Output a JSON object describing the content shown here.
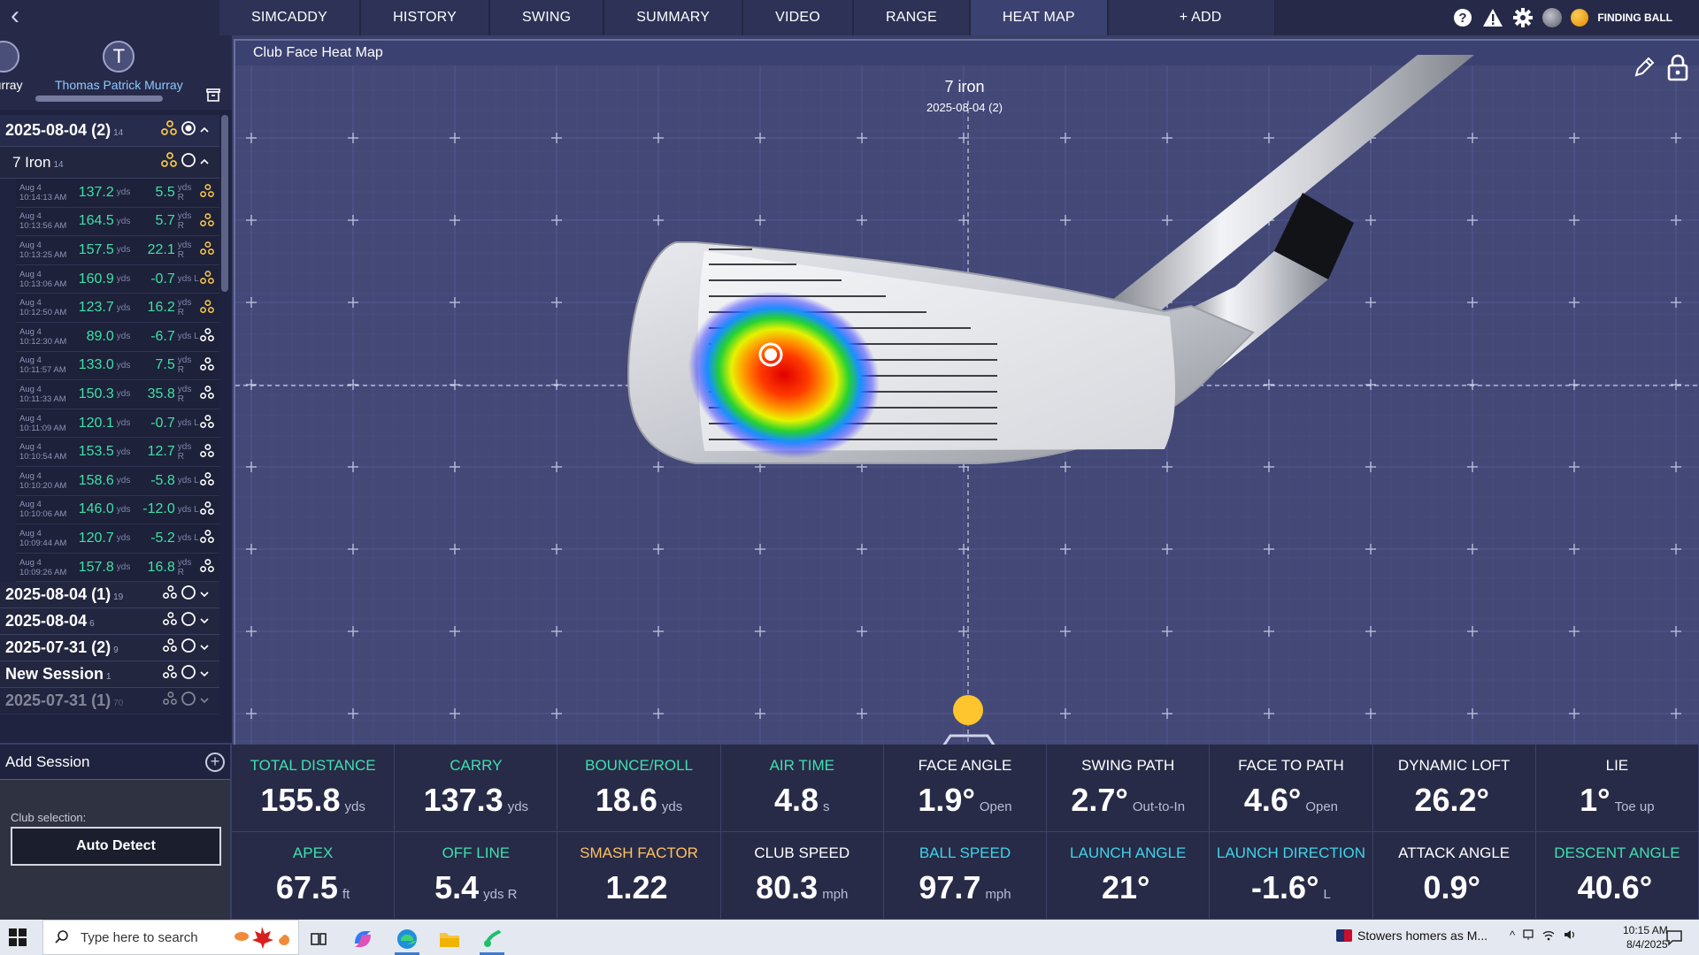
{
  "nav": {
    "tabs": [
      "SIMCADDY",
      "HISTORY",
      "SWING",
      "SUMMARY",
      "VIDEO",
      "RANGE",
      "HEAT MAP",
      "+ ADD"
    ],
    "active_tab": "HEAT MAP",
    "status_text": "FINDING BALL"
  },
  "players": [
    {
      "initial": "",
      "name": "Murray"
    },
    {
      "initial": "T",
      "name": "Thomas Patrick Murray"
    }
  ],
  "sessions_top": {
    "name": "2025-08-04 (2)",
    "count": "14"
  },
  "club_group": {
    "name": "7 Iron",
    "count": "14"
  },
  "shots": [
    {
      "date": "Aug 4",
      "time": "10:14:13 AM",
      "dist": "137.2",
      "offline": "5.5",
      "side": "R"
    },
    {
      "date": "Aug 4",
      "time": "10:13:56 AM",
      "dist": "164.5",
      "offline": "5.7",
      "side": "R"
    },
    {
      "date": "Aug 4",
      "time": "10:13:25 AM",
      "dist": "157.5",
      "offline": "22.1",
      "side": "R"
    },
    {
      "date": "Aug 4",
      "time": "10:13:06 AM",
      "dist": "160.9",
      "offline": "-0.7",
      "side": "L"
    },
    {
      "date": "Aug 4",
      "time": "10:12:50 AM",
      "dist": "123.7",
      "offline": "16.2",
      "side": "R"
    },
    {
      "date": "Aug 4",
      "time": "10:12:30 AM",
      "dist": "89.0",
      "offline": "-6.7",
      "side": "L"
    },
    {
      "date": "Aug 4",
      "time": "10:11:57 AM",
      "dist": "133.0",
      "offline": "7.5",
      "side": "R"
    },
    {
      "date": "Aug 4",
      "time": "10:11:33 AM",
      "dist": "150.3",
      "offline": "35.8",
      "side": "R"
    },
    {
      "date": "Aug 4",
      "time": "10:11:09 AM",
      "dist": "120.1",
      "offline": "-0.7",
      "side": "L"
    },
    {
      "date": "Aug 4",
      "time": "10:10:54 AM",
      "dist": "153.5",
      "offline": "12.7",
      "side": "R"
    },
    {
      "date": "Aug 4",
      "time": "10:10:20 AM",
      "dist": "158.6",
      "offline": "-5.8",
      "side": "L"
    },
    {
      "date": "Aug 4",
      "time": "10:10:06 AM",
      "dist": "146.0",
      "offline": "-12.0",
      "side": "L"
    },
    {
      "date": "Aug 4",
      "time": "10:09:44 AM",
      "dist": "120.7",
      "offline": "-5.2",
      "side": "L"
    },
    {
      "date": "Aug 4",
      "time": "10:09:26 AM",
      "dist": "157.8",
      "offline": "16.8",
      "side": "R"
    }
  ],
  "shot_units": {
    "dist": "yds",
    "offline": "yds"
  },
  "sessions_other": [
    {
      "name": "2025-08-04 (1)",
      "count": "19"
    },
    {
      "name": "2025-08-04",
      "count": "6"
    },
    {
      "name": "2025-07-31 (2)",
      "count": "9"
    },
    {
      "name": "New Session",
      "count": "1"
    },
    {
      "name": "2025-07-31 (1)",
      "count": "70"
    }
  ],
  "add_session_label": "Add Session",
  "club_selection": {
    "label": "Club selection:",
    "value": "Auto Detect"
  },
  "panel": {
    "title": "Club Face Heat Map",
    "club": "7 iron",
    "session": "2025-08-04 (2)"
  },
  "metrics": [
    {
      "label": "TOTAL DISTANCE",
      "value": "155.8",
      "unit": "yds",
      "color": "green"
    },
    {
      "label": "CARRY",
      "value": "137.3",
      "unit": "yds",
      "color": "green"
    },
    {
      "label": "BOUNCE/ROLL",
      "value": "18.6",
      "unit": "yds",
      "color": "green"
    },
    {
      "label": "AIR TIME",
      "value": "4.8",
      "unit": "s",
      "color": "green"
    },
    {
      "label": "FACE ANGLE",
      "value": "1.9°",
      "unit": "Open",
      "color": "white"
    },
    {
      "label": "SWING PATH",
      "value": "2.7°",
      "unit": "Out-to-In",
      "color": "white"
    },
    {
      "label": "FACE TO PATH",
      "value": "4.6°",
      "unit": "Open",
      "color": "white"
    },
    {
      "label": "DYNAMIC LOFT",
      "value": "26.2°",
      "unit": "",
      "color": "white"
    },
    {
      "label": "LIE",
      "value": "1°",
      "unit": "Toe up",
      "color": "white"
    },
    {
      "label": "APEX",
      "value": "67.5",
      "unit": "ft",
      "color": "green"
    },
    {
      "label": "OFF LINE",
      "value": "5.4",
      "unit": "yds R",
      "color": "green"
    },
    {
      "label": "SMASH FACTOR",
      "value": "1.22",
      "unit": "",
      "color": "orange"
    },
    {
      "label": "CLUB SPEED",
      "value": "80.3",
      "unit": "mph",
      "color": "white"
    },
    {
      "label": "BALL SPEED",
      "value": "97.7",
      "unit": "mph",
      "color": "blue"
    },
    {
      "label": "LAUNCH ANGLE",
      "value": "21°",
      "unit": "",
      "color": "blue"
    },
    {
      "label": "LAUNCH DIRECTION",
      "value": "-1.6°",
      "unit": "L",
      "color": "blue"
    },
    {
      "label": "ATTACK ANGLE",
      "value": "0.9°",
      "unit": "",
      "color": "white"
    },
    {
      "label": "DESCENT ANGLE",
      "value": "40.6°",
      "unit": "",
      "color": "green"
    }
  ],
  "colors": {
    "green": "#3fe0b0",
    "white": "#ffffff",
    "orange": "#ffc062",
    "blue": "#3fd4ea"
  },
  "taskbar": {
    "search_placeholder": "Type here to search",
    "news": "Stowers homers as M...",
    "time": "10:15 AM",
    "date": "8/4/2025"
  }
}
